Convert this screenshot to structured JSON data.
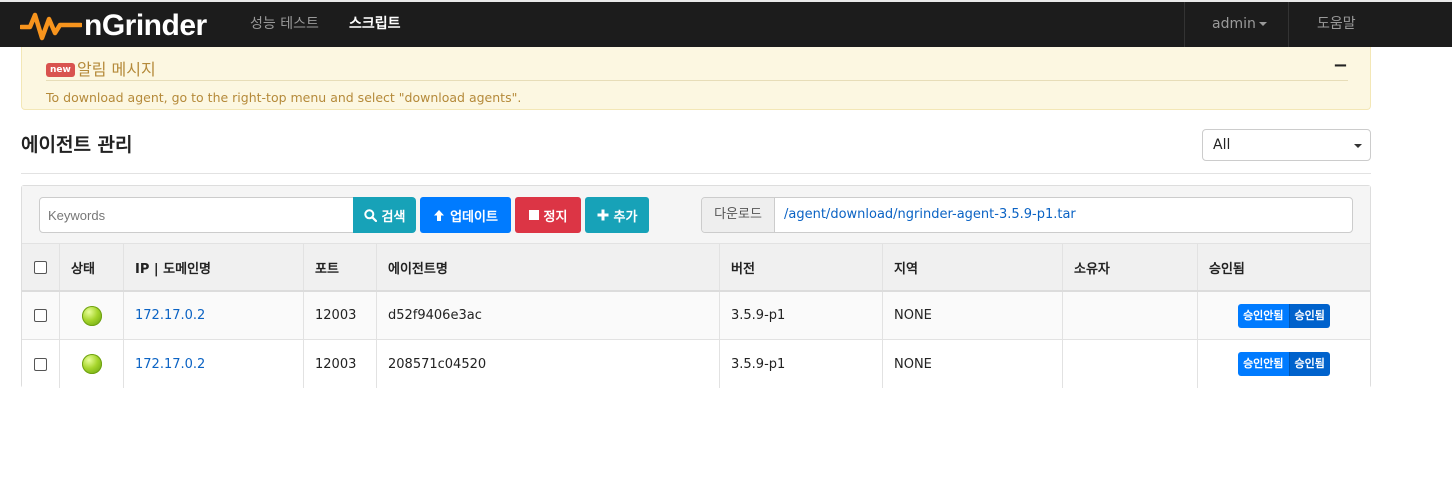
{
  "navbar": {
    "brand": "nGrinder",
    "items": [
      {
        "label": "성능 테스트",
        "active": false
      },
      {
        "label": "스크립트",
        "active": true
      }
    ],
    "user_menu": "admin",
    "help": "도움말"
  },
  "alert": {
    "badge": "new",
    "title": "알림 메시지",
    "collapse": "−",
    "message": "To download agent, go to the right-top menu and select \"download agents\"."
  },
  "page": {
    "title": "에이전트 관리",
    "region_select": "All"
  },
  "toolbar": {
    "search_placeholder": "Keywords",
    "search_button": "검색",
    "update_button": "업데이트",
    "stop_button": "정지",
    "add_button": "추가",
    "download_label": "다운로드",
    "download_link": "/agent/download/ngrinder-agent-3.5.9-p1.tar"
  },
  "table": {
    "headers": {
      "status": "상태",
      "ip": "IP | 도메인명",
      "port": "포트",
      "name": "에이전트명",
      "version": "버전",
      "region": "지역",
      "owner": "소유자",
      "approved": "승인됨"
    },
    "rows": [
      {
        "ip": "172.17.0.2",
        "port": "12003",
        "name": "d52f9406e3ac",
        "version": "3.5.9-p1",
        "region": "NONE",
        "owner": "",
        "disapprove_label": "승인안됨",
        "approve_label": "승인됨"
      },
      {
        "ip": "172.17.0.2",
        "port": "12003",
        "name": "208571c04520",
        "version": "3.5.9-p1",
        "region": "NONE",
        "owner": "",
        "disapprove_label": "승인안됨",
        "approve_label": "승인됨"
      }
    ]
  },
  "colors": {
    "navbar_bg": "#1c1c1c",
    "brand_orange": "#f7941d",
    "alert_bg": "#fcf7e1",
    "primary": "#007bff",
    "info": "#17a2b8",
    "danger": "#dc3545",
    "status_online": "#a6d52c"
  }
}
